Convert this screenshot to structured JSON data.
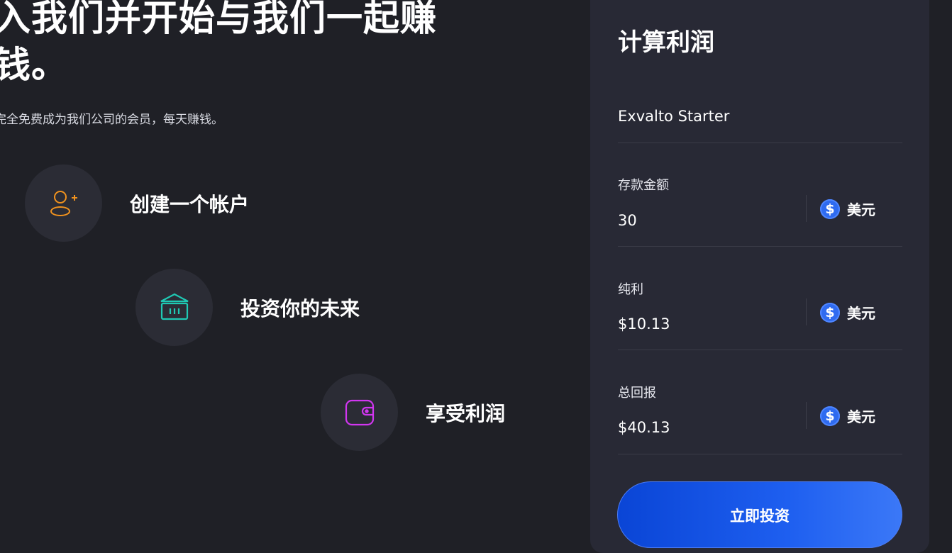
{
  "hero": {
    "headline": "入我们并开始与我们一起赚钱。",
    "subtext": "完全免费成为我们公司的会员，每天赚钱。"
  },
  "steps": [
    {
      "label": "创建一个帐户",
      "icon": "user-add-icon",
      "color": "#f0921e"
    },
    {
      "label": "投资你的未来",
      "icon": "bank-icon",
      "color": "#1fc9b4"
    },
    {
      "label": "享受利润",
      "icon": "wallet-icon",
      "color": "#d136f0"
    }
  ],
  "calculator": {
    "title": "计算利润",
    "plan": "Exvalto Starter",
    "fields": [
      {
        "label": "存款金额",
        "value": "30",
        "currency": "美元"
      },
      {
        "label": "纯利",
        "value": "$10.13",
        "currency": "美元"
      },
      {
        "label": "总回报",
        "value": "$40.13",
        "currency": "美元"
      }
    ],
    "currency_symbol": "$",
    "button_label": "立即投资"
  },
  "colors": {
    "background": "#1f2026",
    "panel": "#282935",
    "accent_blue": "#2f6bf0"
  }
}
